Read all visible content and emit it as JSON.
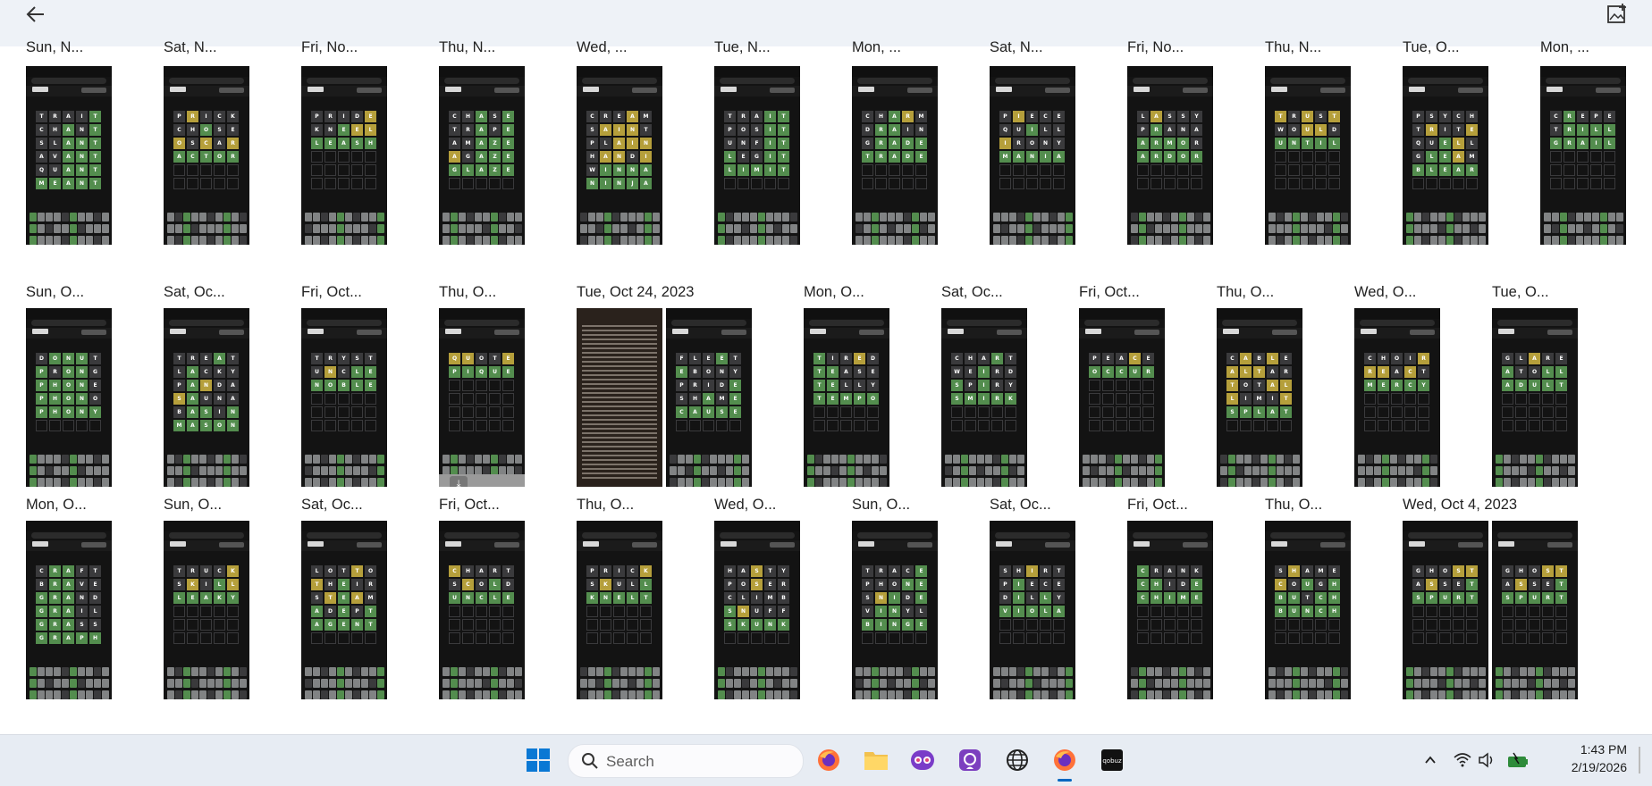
{
  "toolbar": {
    "back_icon": "arrow-left-icon",
    "add_image_icon": "add-image-icon"
  },
  "gallery": {
    "rows": [
      {
        "groups": [
          {
            "label": "Sun, N...",
            "photos": [
              {
                "words": [
                  "TRAIT",
                  "CHANT",
                  "SLANT",
                  "AVANT",
                  "QUANT",
                  "MEANT"
                ],
                "fb": [
                  "xxxxg",
                  "xxgxg",
                  "xxggg",
                  "xxggg",
                  "xxggg",
                  "gggggg"
                ]
              }
            ]
          },
          {
            "label": "Sat, N...",
            "photos": [
              {
                "words": [
                  "PRICK",
                  "CHOSE",
                  "OSCAR",
                  "ACTOR"
                ],
                "fb": [
                  "xyxxx",
                  "xxgxx",
                  "yxyxy",
                  "ggggg"
                ]
              }
            ]
          },
          {
            "label": "Fri, No...",
            "photos": [
              {
                "words": [
                  "PRIDE",
                  "KNEEL",
                  "LEASH"
                ],
                "fb": [
                  "xxxxy",
                  "xxgyy",
                  "ggggg"
                ]
              }
            ]
          },
          {
            "label": "Thu, N...",
            "photos": [
              {
                "words": [
                  "CHASE",
                  "TRAPE",
                  "AMAZE",
                  "AGAZE",
                  "GLAZE"
                ],
                "fb": [
                  "xxgxg",
                  "xxgxg",
                  "xxggg",
                  "yxggg",
                  "ggggg"
                ]
              }
            ]
          },
          {
            "label": "Wed, ...",
            "photos": [
              {
                "words": [
                  "CREAM",
                  "SAINT",
                  "PLAIN",
                  "HANDI",
                  "WINNA",
                  "NINJA"
                ],
                "fb": [
                  "xxxyx",
                  "xyyyx",
                  "xxyyy",
                  "xyyxy",
                  "xgggg",
                  "ggggg"
                ]
              }
            ]
          },
          {
            "label": "Tue, N...",
            "photos": [
              {
                "words": [
                  "TRAIT",
                  "POSIT",
                  "UNFIT",
                  "LEGIT",
                  "LIMIT"
                ],
                "fb": [
                  "xxxgg",
                  "xxxgg",
                  "xxxgg",
                  "gxxgg",
                  "ggggg"
                ]
              }
            ]
          },
          {
            "label": "Mon, ...",
            "photos": [
              {
                "words": [
                  "CHARM",
                  "DRAIN",
                  "GRADE",
                  "TRADE"
                ],
                "fb": [
                  "xxgyx",
                  "xggxx",
                  "xgggg",
                  "ggggg"
                ]
              }
            ]
          },
          {
            "label": "Sat, N...",
            "photos": [
              {
                "words": [
                  "PIECE",
                  "QUILL",
                  "IRONY",
                  "MANIA"
                ],
                "fb": [
                  "xyxxx",
                  "xxgxx",
                  "yxxxx",
                  "ggggg"
                ]
              }
            ]
          },
          {
            "label": "Fri, No...",
            "photos": [
              {
                "words": [
                  "LASSY",
                  "PRANA",
                  "ARMOR",
                  "ARDOR"
                ],
                "fb": [
                  "xyxxx",
                  "xgxxx",
                  "gggg",
                  "ggggg"
                ]
              }
            ]
          },
          {
            "label": "Thu, N...",
            "photos": [
              {
                "words": [
                  "TRUST",
                  "WOULD",
                  "UNTIL"
                ],
                "fb": [
                  "yxyxy",
                  "xxyyx",
                  "ggggg"
                ]
              }
            ]
          },
          {
            "label": "Tue, O...",
            "photos": [
              {
                "words": [
                  "PSYCH",
                  "TRITE",
                  "QUELL",
                  "GLEAM",
                  "BLEAR"
                ],
                "fb": [
                  "xxxxx",
                  "xyxxy",
                  "xxgyx",
                  "xggyx",
                  "ggggg"
                ]
              }
            ]
          },
          {
            "label": "Mon, ...",
            "photos": [
              {
                "words": [
                  "CREPE",
                  "TRILL",
                  "GRAIL"
                ],
                "fb": [
                  "xgxxx",
                  "xgggg",
                  "ggggg"
                ]
              }
            ]
          }
        ]
      },
      {
        "groups": [
          {
            "label": "Sun, O...",
            "photos": [
              {
                "words": [
                  "DONUT",
                  "PRONG",
                  "PHONE",
                  "PHONO",
                  "PHONY"
                ],
                "fb": [
                  "xgggx",
                  "gxggx",
                  "ggggx",
                  "ggggx",
                  "ggggg"
                ]
              }
            ]
          },
          {
            "label": "Sat, Oc...",
            "photos": [
              {
                "words": [
                  "TREAT",
                  "LACKY",
                  "PANDA",
                  "SAUNA",
                  "BASIN",
                  "MASON"
                ],
                "fb": [
                  "xxxgx",
                  "xgxxx",
                  "xgyxx",
                  "ygxxx",
                  "xggxg",
                  "ggggg"
                ]
              }
            ]
          },
          {
            "label": "Fri, Oct...",
            "photos": [
              {
                "words": [
                  "TRYST",
                  "UNCLE",
                  "NOBLE"
                ],
                "fb": [
                  "xxxxx",
                  "xyxgg",
                  "ggggg"
                ]
              }
            ]
          },
          {
            "label": "Thu, O...",
            "photos": [
              {
                "words": [
                  "QUOTE",
                  "PIQUE"
                ],
                "fb": [
                  "yyxxy",
                  "ggggg"
                ]
              }
            ]
          },
          {
            "label": "Tue, Oct 24, 2023",
            "photos": [
              {
                "doc": true
              },
              {
                "words": [
                  "FLEET",
                  "EBONY",
                  "PRIDE",
                  "SHAME",
                  "CAUSE"
                ],
                "fb": [
                  "xxxgx",
                  "gxxxx",
                  "xxxxg",
                  "xxgxg",
                  "ggggg"
                ]
              }
            ]
          },
          {
            "label": "Mon, O...",
            "photos": [
              {
                "words": [
                  "TIRED",
                  "TEASE",
                  "TELLY",
                  "TEMPO"
                ],
                "fb": [
                  "gxxyx",
                  "ggxxx",
                  "ggxxx",
                  "ggggg"
                ]
              }
            ]
          },
          {
            "label": "Sat, Oc...",
            "photos": [
              {
                "words": [
                  "CHART",
                  "WEIRD",
                  "SPIRY",
                  "SMIRK"
                ],
                "fb": [
                  "xxxgx",
                  "xxgxx",
                  "gxgxx",
                  "ggggg"
                ]
              }
            ]
          },
          {
            "label": "Fri, Oct...",
            "photos": [
              {
                "words": [
                  "PEACE",
                  "OCCUR"
                ],
                "fb": [
                  "xxxyx",
                  "ggggg"
                ]
              }
            ]
          },
          {
            "label": "Thu, O...",
            "photos": [
              {
                "words": [
                  "CABLE",
                  "ALTAR",
                  "TOTAL",
                  "LIMIT",
                  "SPLAT"
                ],
                "fb": [
                  "xyxyx",
                  "yyyxx",
                  "yxxyy",
                  "yxxxy",
                  "ggggg"
                ]
              }
            ]
          },
          {
            "label": "Wed, O...",
            "photos": [
              {
                "words": [
                  "CHOIR",
                  "REACT",
                  "MERCY"
                ],
                "fb": [
                  "xxxxy",
                  "yyxyx",
                  "ggggg"
                ]
              }
            ]
          },
          {
            "label": "Tue, O...",
            "photos": [
              {
                "words": [
                  "GLARE",
                  "ATOLL",
                  "ADULT"
                ],
                "fb": [
                  "xxyxx",
                  "gxxgg",
                  "ggggg"
                ]
              }
            ]
          }
        ]
      },
      {
        "groups": [
          {
            "label": "Mon, O...",
            "photos": [
              {
                "words": [
                  "CRAFT",
                  "BRAVE",
                  "GRAND",
                  "GRAIL",
                  "GRASS",
                  "GRAPH"
                ],
                "fb": [
                  "xggxx",
                  "xggxx",
                  "gggxx",
                  "gggxx",
                  "gggxx",
                  "ggggg"
                ]
              }
            ]
          },
          {
            "label": "Sun, O...",
            "photos": [
              {
                "words": [
                  "TRUCK",
                  "SKILL",
                  "LEAKY"
                ],
                "fb": [
                  "xxxxy",
                  "xyxgy",
                  "ggggg"
                ]
              }
            ]
          },
          {
            "label": "Sat, Oc...",
            "photos": [
              {
                "words": [
                  "LOTTO",
                  "THEIR",
                  "STEAM",
                  "ADEPT",
                  "AGENT"
                ],
                "fb": [
                  "xxxyx",
                  "yxgxx",
                  "xygyx",
                  "gxgxg",
                  "ggggg"
                ]
              }
            ]
          },
          {
            "label": "Fri, Oct...",
            "photos": [
              {
                "words": [
                  "CHART",
                  "SCOLD",
                  "UNCLE"
                ],
                "fb": [
                  "yxxxx",
                  "xyxgx",
                  "ggggg"
                ]
              }
            ]
          },
          {
            "label": "Thu, O...",
            "photos": [
              {
                "words": [
                  "PRICK",
                  "SKULL",
                  "KNELT"
                ],
                "fb": [
                  "xxxxy",
                  "xyxxg",
                  "ggggg"
                ]
              }
            ]
          },
          {
            "label": "Wed, O...",
            "photos": [
              {
                "words": [
                  "HASTY",
                  "POSER",
                  "CLIMB",
                  "SNUFF",
                  "SKUNK"
                ],
                "fb": [
                  "xxyxx",
                  "xxyxx",
                  "xxxxx",
                  "gyxxx",
                  "ggggg"
                ]
              }
            ]
          },
          {
            "label": "Sun, O...",
            "photos": [
              {
                "words": [
                  "TRACE",
                  "PHONE",
                  "SNIDE",
                  "VINYL",
                  "BINGE"
                ],
                "fb": [
                  "xxxxg",
                  "xxxgg",
                  "xygxg",
                  "xggxx",
                  "ggggg"
                ]
              }
            ]
          },
          {
            "label": "Sat, Oc...",
            "photos": [
              {
                "words": [
                  "SHIRT",
                  "PIECE",
                  "DILLY",
                  "VIOLA"
                ],
                "fb": [
                  "xxyxx",
                  "xgxxx",
                  "xgxgx",
                  "ggggg"
                ]
              }
            ]
          },
          {
            "label": "Fri, Oct...",
            "photos": [
              {
                "words": [
                  "CRANK",
                  "CHIDE",
                  "CHIME"
                ],
                "fb": [
                  "gxxxx",
                  "ggxxg",
                  "ggggg"
                ]
              }
            ]
          },
          {
            "label": "Thu, O...",
            "photos": [
              {
                "words": [
                  "SHAME",
                  "COUGH",
                  "BUTCH",
                  "BUNCH"
                ],
                "fb": [
                  "xyxxx",
                  "yxgxg",
                  "ggxgg",
                  "ggggg"
                ]
              }
            ]
          },
          {
            "label": "Wed, Oct 4, 2023",
            "photos": [
              {
                "words": [
                  "GHOST",
                  "ASSET",
                  "SPURT"
                ],
                "fb": [
                  "xxxyy",
                  "xyxxg",
                  "ggggg"
                ]
              },
              {
                "words": [
                  "GHOST",
                  "ASSET",
                  "SPURT"
                ],
                "fb": [
                  "xxxyy",
                  "xyxxg",
                  "ggggg"
                ]
              }
            ]
          }
        ]
      }
    ]
  },
  "taskbar": {
    "search_placeholder": "Search",
    "search_icon": "search-icon",
    "apps": [
      "start-icon",
      "firefox-icon",
      "file-explorer-icon",
      "copilot-icon",
      "photos-icon",
      "globe-icon",
      "firefox-active-icon",
      "qobuz-icon"
    ],
    "time": "1:43 PM",
    "date": "2/19/2026",
    "tray_icons": [
      "chevron-up-icon",
      "wifi-icon",
      "volume-icon",
      "battery-icon"
    ]
  },
  "colors": {
    "correct": "#538d4e",
    "present": "#b59f3b",
    "absent": "#3a3a3c",
    "accent": "#0067c0"
  }
}
